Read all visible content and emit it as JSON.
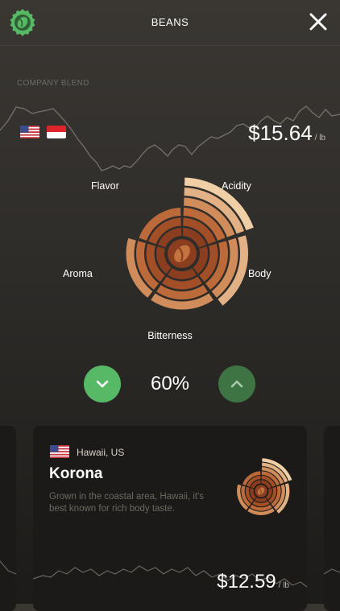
{
  "header": {
    "title": "BEANS",
    "logo_icon": "coffee-bean-badge-icon",
    "close_icon": "close-icon",
    "brand_color": "#57b866"
  },
  "blend": {
    "subtitle": "COMPANY BLEND",
    "flags": [
      "us-flag-icon",
      "indonesia-flag-icon"
    ],
    "price": "$15.64",
    "price_unit": "/ lb"
  },
  "profile": {
    "labels": {
      "flavor": "Flavor",
      "acidity": "Acidity",
      "aroma": "Aroma",
      "body": "Body",
      "bitterness": "Bitterness"
    },
    "levels": {
      "flavor": 3,
      "acidity": 6,
      "body": 5,
      "bitterness": 4,
      "aroma": 4
    },
    "max_level": 6,
    "colors": [
      "#8a3e1f",
      "#a24e27",
      "#bc6a3a",
      "#d08c5b",
      "#e2b286",
      "#f0cfa6"
    ],
    "center_icon": "coffee-bean-icon"
  },
  "controls": {
    "percent": "60%",
    "down_icon": "chevron-down-icon",
    "up_icon": "chevron-up-icon",
    "down_color": "#57b866",
    "up_color": "#3e7443"
  },
  "card": {
    "flag": "us-flag-icon",
    "origin": "Hawaii, US",
    "name": "Korona",
    "description": "Grown in the coastal area, Hawaii, it's best known for rich body taste.",
    "price": "$12.59",
    "price_unit": "/ lb"
  }
}
